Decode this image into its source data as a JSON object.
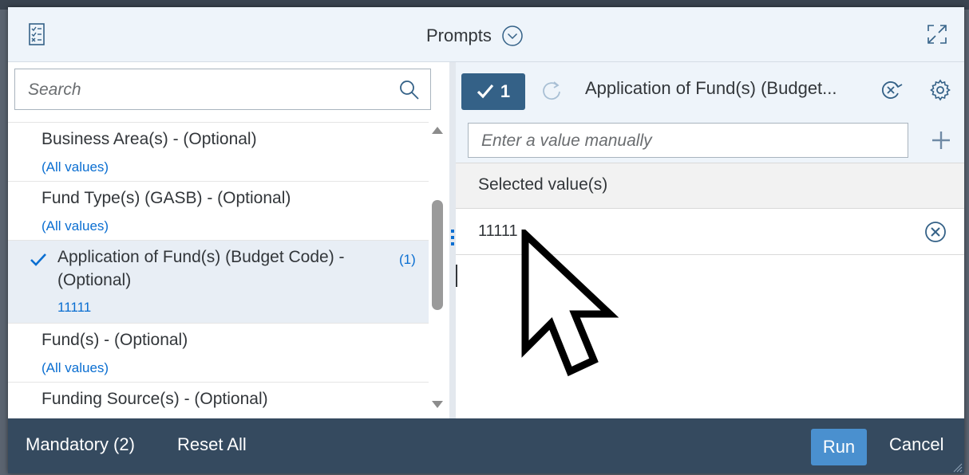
{
  "dialog": {
    "title": "Prompts",
    "icons": {
      "prompts": "checklist-icon",
      "title_menu": "chevron-down-circle-icon",
      "expand": "expand-icon"
    }
  },
  "left_panel": {
    "search_placeholder": "Search",
    "items": [
      {
        "label": "Business Area(s) - (Optional)",
        "value": "(All values)",
        "selected": false
      },
      {
        "label": "Fund Type(s) (GASB) - (Optional)",
        "value": "(All values)",
        "selected": false
      },
      {
        "label_line1": "Application of Fund(s) (Budget Code) -",
        "label_line2": "(Optional)",
        "value": "11111",
        "count": "(1)",
        "selected": true
      },
      {
        "label": "Fund(s) - (Optional)",
        "value": "(All values)",
        "selected": false
      },
      {
        "label": "Funding Source(s) - (Optional)",
        "selected": false
      }
    ]
  },
  "right_panel": {
    "selected_count": "1",
    "prompt_title": "Application of Fund(s) (Budget...",
    "manual_placeholder": "Enter a value manually",
    "selected_header": "Selected value(s)",
    "selected_values": [
      "11111"
    ]
  },
  "footer": {
    "mandatory": "Mandatory (2)",
    "reset_all": "Reset All",
    "run": "Run",
    "cancel": "Cancel"
  },
  "colors": {
    "accent": "#0a6ed1",
    "header_bg": "#eef4fa",
    "footer_bg": "#354a5f",
    "count_button": "#346187",
    "run_button": "#4a90cf"
  }
}
